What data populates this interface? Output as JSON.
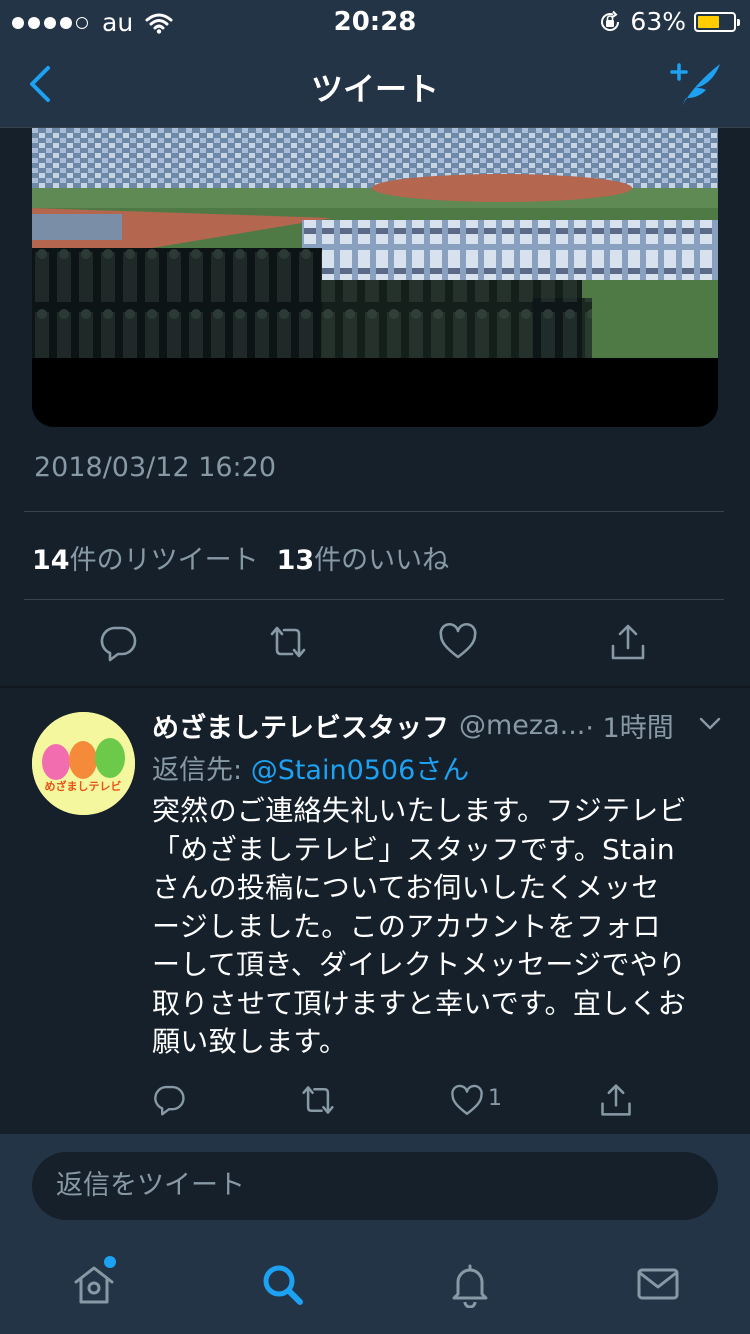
{
  "status_bar": {
    "carrier": "au",
    "time": "20:28",
    "battery_percent": "63%",
    "battery_level": 0.63,
    "signal_dots_filled": 4,
    "signal_dots_total": 5
  },
  "nav": {
    "title": "ツイート"
  },
  "tweet": {
    "timestamp": "2018/03/12 16:20",
    "retweet_count": "14",
    "retweet_label": "件のリツイート",
    "like_count": "13",
    "like_label": "件のいいね"
  },
  "reply": {
    "display_name": "めざましテレビスタッフ",
    "handle": "@meza...",
    "time_ago": "· 1時間",
    "reply_to_prefix": "返信先: ",
    "reply_to_user": "@Stain0506さん",
    "body_lines": [
      "突然のご連絡失礼いたします。フジテレビ",
      "「めざましテレビ」スタッフです。Stain",
      "さんの投稿についてお伺いしたくメッセ",
      "ージしました。このアカウントをフォロ",
      "ーして頂き、ダイレクトメッセージでやり",
      "取りさせて頂けますと幸いです。宜しくお",
      "願い致します。"
    ],
    "like_count": "1",
    "avatar_logo_text": "めざましテレビ"
  },
  "composer": {
    "placeholder": "返信をツイート"
  },
  "colors": {
    "background": "#15202b",
    "bar": "#243447",
    "accent": "#1da1f2",
    "secondary_text": "#8899a6",
    "divider": "#38444d"
  },
  "icons": {
    "nav_back": "chevron-left-icon",
    "nav_compose": "compose-tweet-icon",
    "reply": "reply-icon",
    "retweet": "retweet-icon",
    "like": "heart-icon",
    "share": "share-icon",
    "tab_home": "home-icon",
    "tab_search": "search-icon",
    "tab_notifications": "bell-icon",
    "tab_messages": "envelope-icon"
  }
}
